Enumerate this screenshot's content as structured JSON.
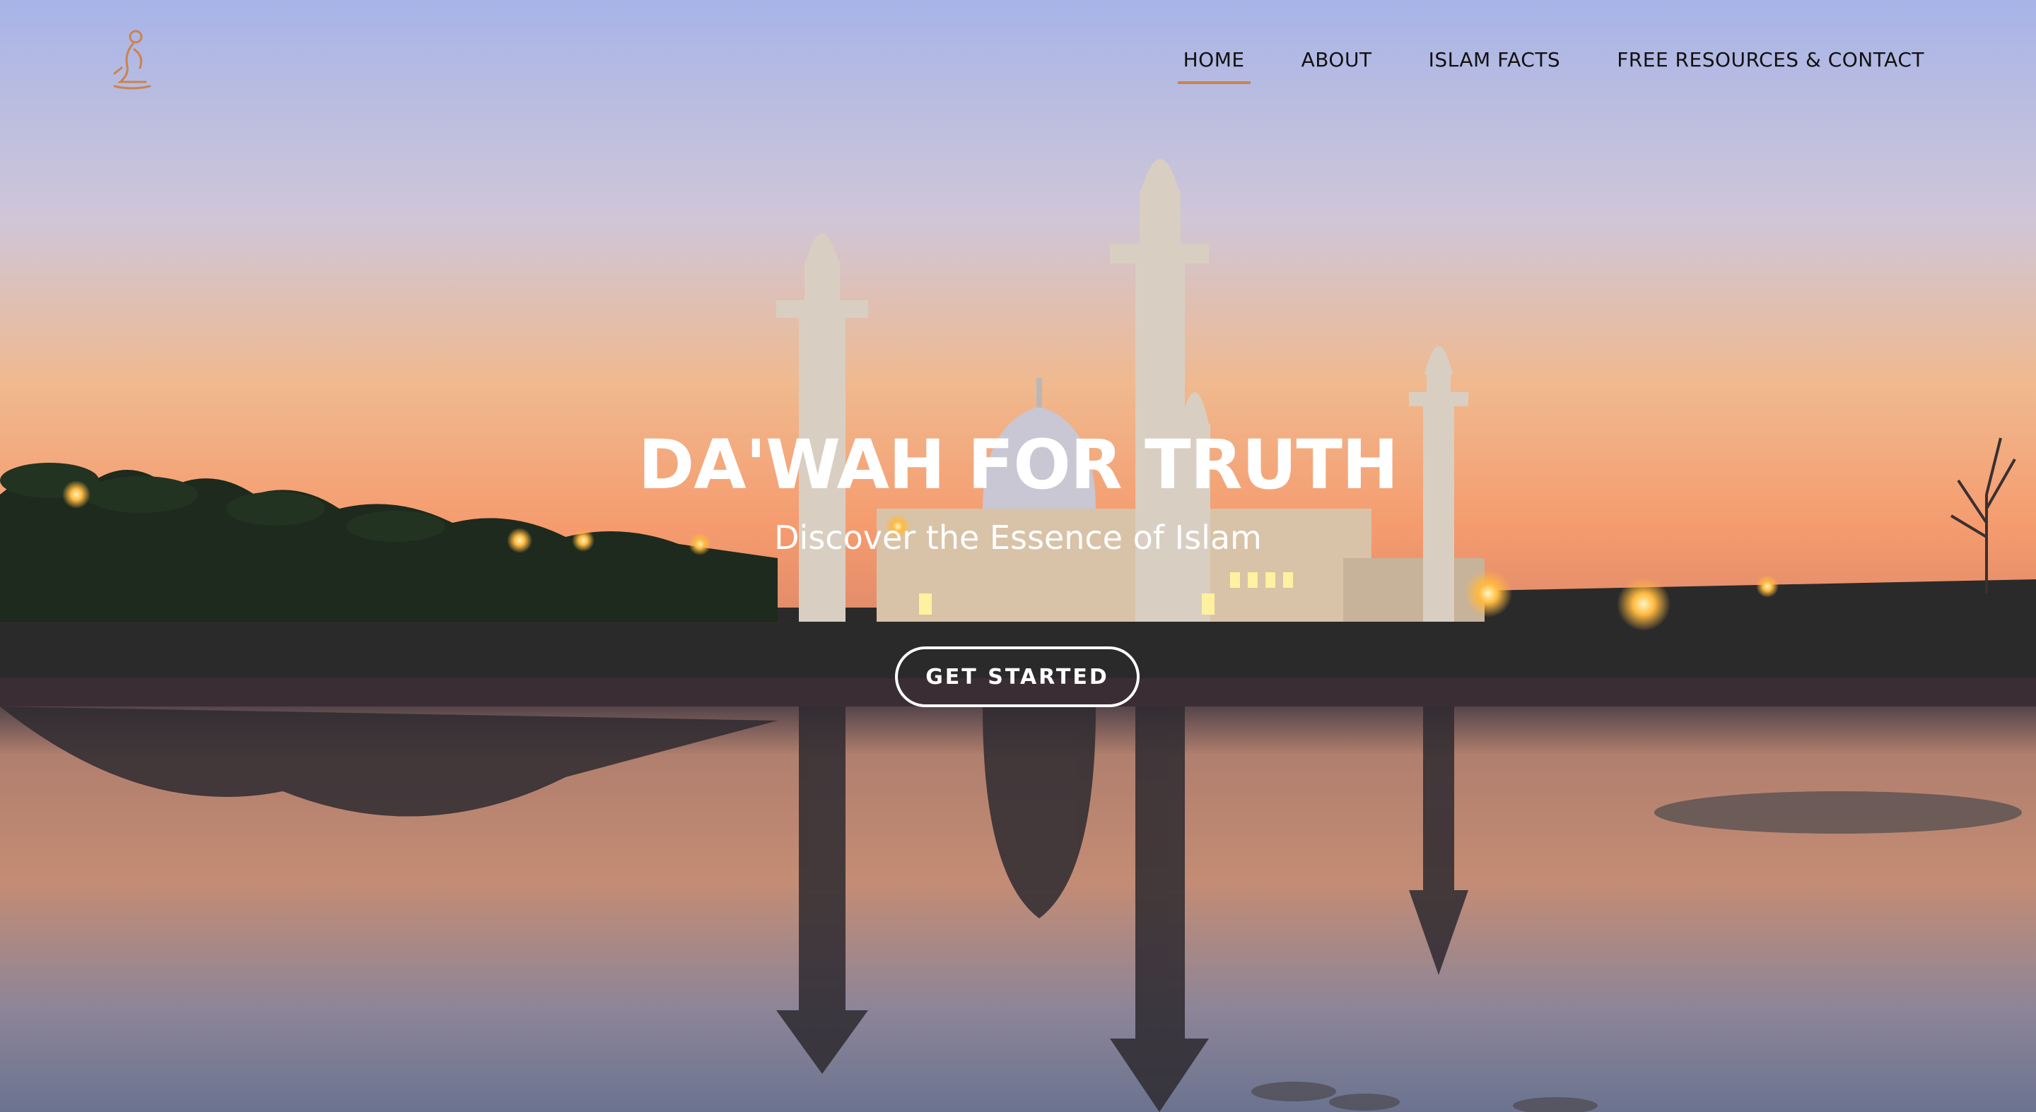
{
  "brand": {
    "logo_icon": "kneeling-figure-icon",
    "accent": "#c9844e"
  },
  "nav": {
    "items": [
      {
        "label": "HOME",
        "active": true
      },
      {
        "label": "ABOUT",
        "active": false
      },
      {
        "label": "ISLAM FACTS",
        "active": false
      },
      {
        "label": "FREE RESOURCES & CONTACT",
        "active": false
      }
    ]
  },
  "hero": {
    "title": "DA'WAH FOR TRUTH",
    "subtitle": "Discover the Essence of Islam",
    "cta_label": "GET STARTED",
    "background_image": "mosque-at-sunset-with-lake-reflection"
  }
}
